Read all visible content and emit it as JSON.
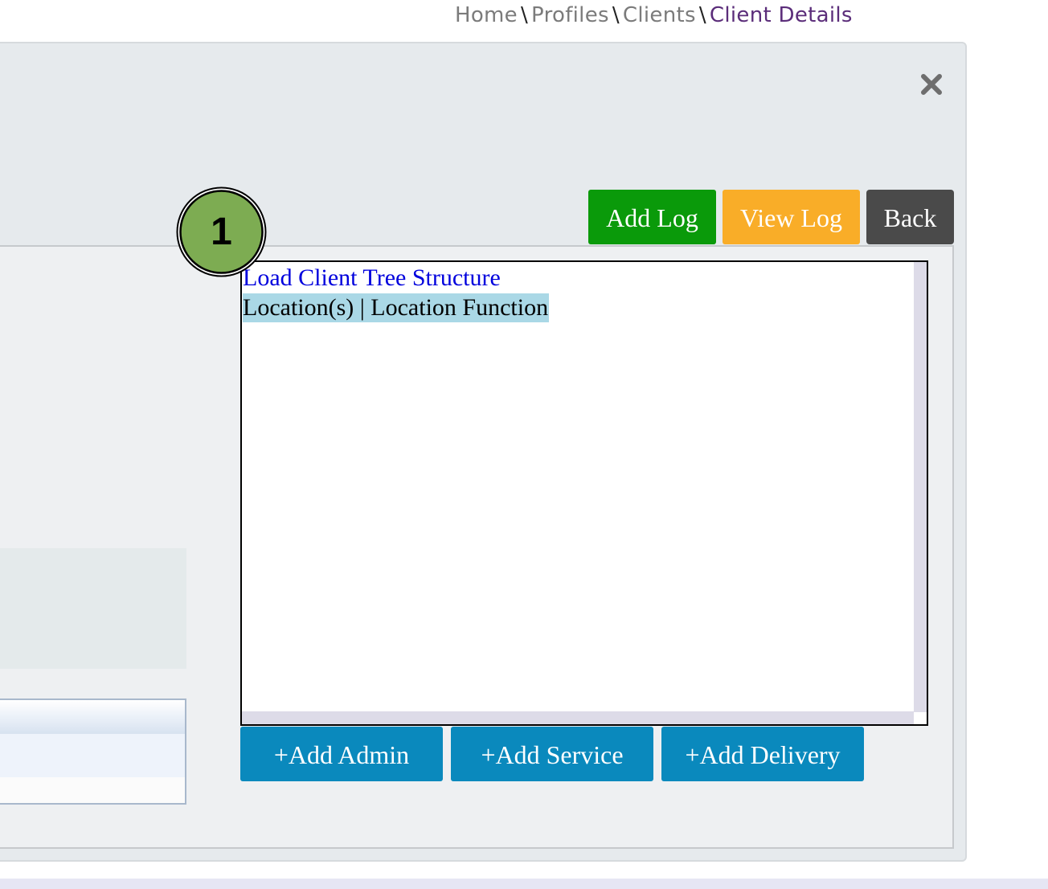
{
  "breadcrumb": {
    "home": "Home",
    "separator": "\\",
    "profiles": "Profiles",
    "clients": "Clients",
    "current": "Client Details"
  },
  "actions": {
    "add_log": "Add Log",
    "view_log": "View Log",
    "back": "Back"
  },
  "tree": {
    "load_link": "Load Client Tree Structure",
    "selected_item": "Location(s) | Location Function"
  },
  "tree_actions": {
    "add_admin": "+Add Admin",
    "add_service": "+Add Service",
    "add_delivery": "+Add Delivery"
  },
  "marker": {
    "number": "1"
  },
  "icons": {
    "close": "close-icon"
  },
  "colors": {
    "add_log": "#0a9a0a",
    "view_log": "#f9ad28",
    "back": "#4a4a4a",
    "tree_buttons": "#0a89bd",
    "link": "#0000dd",
    "selected_highlight": "#aad8e6",
    "breadcrumb_current": "#5b2d7a",
    "marker_fill": "#7dac52"
  }
}
